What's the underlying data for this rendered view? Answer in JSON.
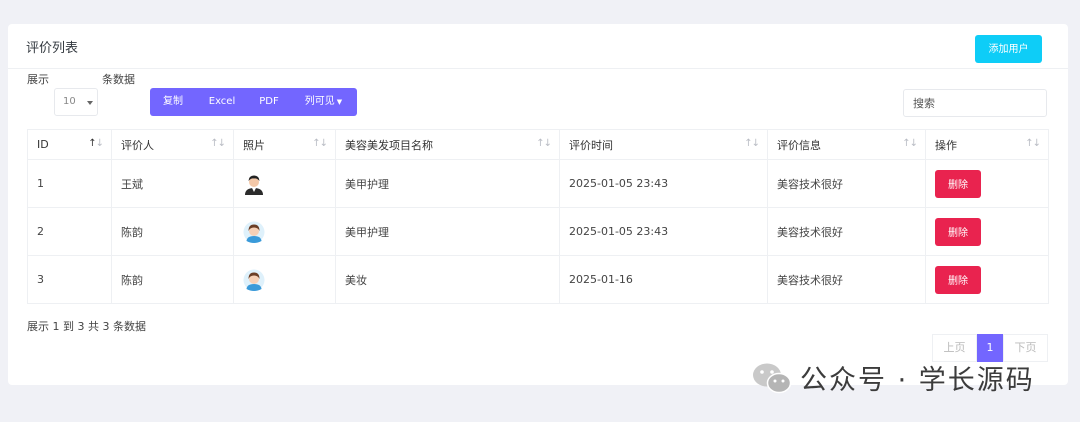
{
  "header": {
    "title": "评价列表",
    "add_button": "添加用户"
  },
  "toolbar": {
    "show_label": "展示",
    "page_size": "10",
    "rows_label": "条数据",
    "export_buttons": [
      "复制",
      "Excel",
      "PDF",
      "列可见"
    ],
    "search_placeholder": "搜索"
  },
  "table": {
    "columns": [
      "ID",
      "评价人",
      "照片",
      "美容美发项目名称",
      "评价时间",
      "评价信息",
      "操作"
    ],
    "rows": [
      {
        "id": "1",
        "reviewer": "王斌",
        "avatar": "male-avatar-icon",
        "project": "美甲护理",
        "time": "2025-01-05 23:43",
        "info": "美容技术很好",
        "action": "删除"
      },
      {
        "id": "2",
        "reviewer": "陈韵",
        "avatar": "female-avatar-icon",
        "project": "美甲护理",
        "time": "2025-01-05 23:43",
        "info": "美容技术很好",
        "action": "删除"
      },
      {
        "id": "3",
        "reviewer": "陈韵",
        "avatar": "female-avatar-icon",
        "project": "美妆",
        "time": "2025-01-16",
        "info": "美容技术很好",
        "action": "删除"
      }
    ]
  },
  "footer": {
    "summary": "展示 1 到 3 共 3 条数据",
    "prev": "上页",
    "current_page": "1",
    "next": "下页"
  },
  "watermark": {
    "text": "公众号 · 学长源码"
  },
  "colors": {
    "primary": "#7366ff",
    "info": "#0ecdf7",
    "danger": "#e9234f",
    "background": "#f0f1f6"
  }
}
